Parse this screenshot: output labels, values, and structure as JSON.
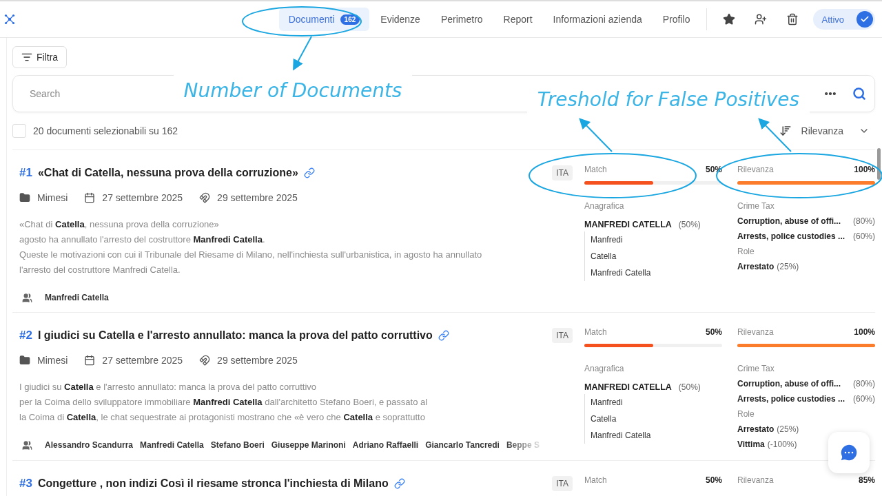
{
  "nav": {
    "tabs": [
      {
        "label": "Documenti",
        "badge": "162",
        "selected": true
      },
      {
        "label": "Evidenze",
        "selected": false
      },
      {
        "label": "Perimetro",
        "selected": false
      },
      {
        "label": "Report",
        "selected": false
      },
      {
        "label": "Informazioni azienda",
        "selected": false
      },
      {
        "label": "Profilo",
        "selected": false
      }
    ],
    "status_toggle": {
      "label": "Attivo",
      "on": true
    }
  },
  "toolbar": {
    "filter_button": "Filtra",
    "search": {
      "placeholder": "Search"
    }
  },
  "selection": {
    "label": "20 documenti selezionabili su 162",
    "checked": false,
    "sort": "Rilevanza"
  },
  "documents": [
    {
      "number": "#1",
      "title": "«Chat di Catella, nessuna prova della corruzione»",
      "language": "ITA",
      "source": "Mimesi",
      "published": "27 settembre 2025",
      "collected": "29 settembre 2025",
      "snippet": [
        "«Chat di **Catella**, nessuna prova della corruzione»",
        "agosto ha annullato l'arresto del costruttore **Manfredi Catella**.",
        "Queste le motivazioni con cui il Tribunale del Riesame di Milano, nell'inchiesta sull'urbanistica, in agosto ha annullato",
        "l'arresto del costruttore Manfredi Catella."
      ],
      "people": [
        "Manfredi Catella"
      ],
      "match": {
        "label": "Match",
        "value": "50%",
        "level": 0.5
      },
      "relevance": {
        "label": "Rilevanza",
        "value": "100%",
        "level": 1
      },
      "registry": {
        "label": "Anagrafica",
        "name": "MANFREDI CATELLA",
        "score": "(50%)",
        "aliases": [
          "Manfredi",
          "Catella",
          "Manfredi Catella"
        ]
      },
      "crime_tax": {
        "label": "Crime Tax",
        "items": [
          {
            "name": "Corruption, abuse of offi...",
            "score": "(80%)"
          },
          {
            "name": "Arrests, police custodies ...",
            "score": "(60%)"
          }
        ]
      },
      "role": {
        "label": "Role",
        "items": [
          {
            "name": "Arrestato",
            "score": "(25%)"
          }
        ]
      }
    },
    {
      "number": "#2",
      "title": "I giudici su Catella e l'arresto annullato: manca la prova del patto corruttivo",
      "language": "ITA",
      "source": "Mimesi",
      "published": "27 settembre 2025",
      "collected": "29 settembre 2025",
      "snippet": [
        "I giudici su **Catella** e l'arresto annullato: manca la prova del patto corruttivo",
        "per la Coima dello sviluppatore immobiliare **Manfredi Catella** dall'architetto Stefano Boeri, e passato al",
        "la Coima di **Catella**, le chat sequestrate ai protagonisti mostrano che «è vero che **Catella** e soprattutto"
      ],
      "people": [
        "Alessandro Scandurra",
        "Manfredi Catella",
        "Stefano Boeri",
        "Giuseppe Marinoni",
        "Adriano Raffaelli",
        "Giancarlo Tancredi",
        "Beppe S"
      ],
      "match": {
        "label": "Match",
        "value": "50%",
        "level": 0.5
      },
      "relevance": {
        "label": "Rilevanza",
        "value": "100%",
        "level": 1
      },
      "registry": {
        "label": "Anagrafica",
        "name": "MANFREDI CATELLA",
        "score": "(50%)",
        "aliases": [
          "Manfredi",
          "Catella",
          "Manfredi Catella"
        ]
      },
      "crime_tax": {
        "label": "Crime Tax",
        "items": [
          {
            "name": "Corruption, abuse of offi...",
            "score": "(80%)"
          },
          {
            "name": "Arrests, police custodies ...",
            "score": "(60%)"
          }
        ]
      },
      "role": {
        "label": "Role",
        "items": [
          {
            "name": "Arrestato",
            "score": "(25%)"
          },
          {
            "name": "Vittima",
            "score": "(-100%)"
          }
        ]
      }
    },
    {
      "number": "#3",
      "title": "Congetture , non indizi Così il riesame stronca l'inchiesta di Milano",
      "language": "ITA",
      "match": {
        "label": "Match",
        "value": "50%"
      },
      "relevance": {
        "label": "Rilevanza",
        "value": "85%"
      }
    }
  ],
  "annotations": [
    {
      "text": "Number of Documents"
    },
    {
      "text": "Treshold for False Positives"
    }
  ]
}
